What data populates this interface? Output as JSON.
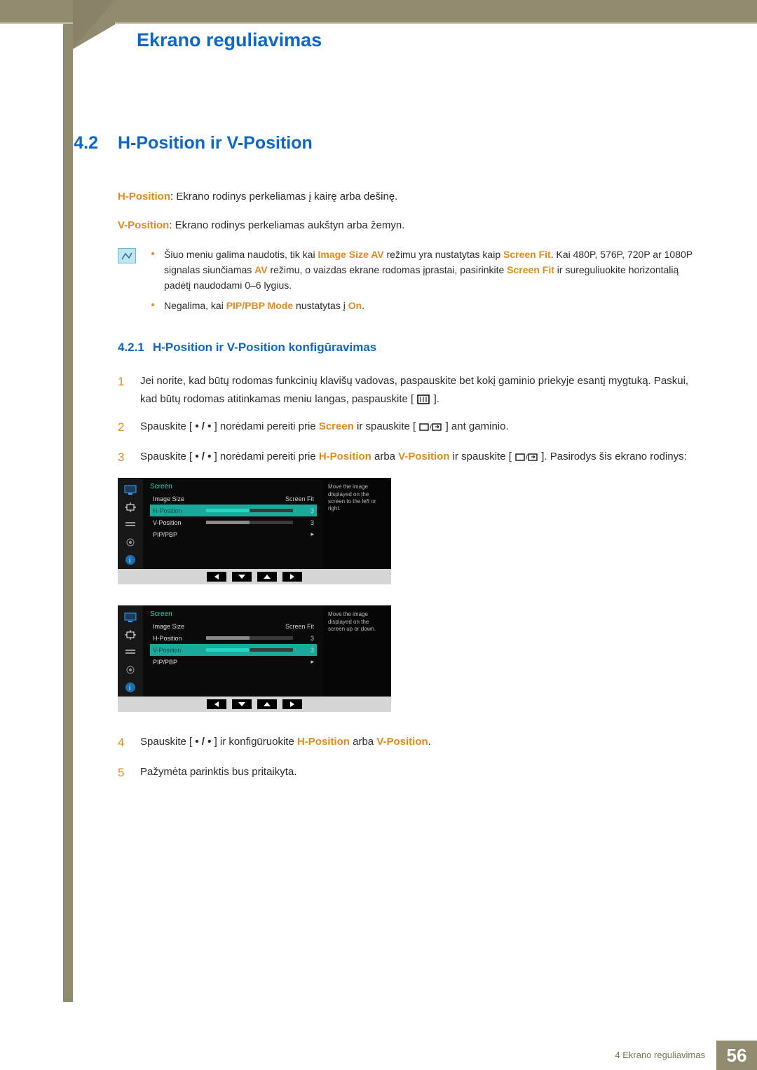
{
  "header": {
    "title": "Ekrano reguliavimas"
  },
  "section": {
    "num": "4.2",
    "title": "H-Position ir V-Position"
  },
  "intro": {
    "hpos_label": "H-Position",
    "hpos_text": ": Ekrano rodinys perkeliamas į kairę arba dešinę.",
    "vpos_label": "V-Position",
    "vpos_text": ": Ekrano rodinys perkeliamas aukštyn arba žemyn."
  },
  "note": {
    "b1_a": "Šiuo meniu galima naudotis, tik kai ",
    "b1_k1": "Image Size AV",
    "b1_b": " režimu yra nustatytas kaip ",
    "b1_k2": "Screen Fit",
    "b1_c": ". Kai 480P, 576P, 720P ar 1080P signalas siunčiamas ",
    "b1_k3": "AV",
    "b1_d": " režimu, o vaizdas ekrane rodomas įprastai, pasirinkite ",
    "b1_k4": "Screen Fit",
    "b1_e": " ir sureguliuokite horizontalią padėtį naudodami 0–6 lygius.",
    "b2_a": "Negalima, kai ",
    "b2_k1": "PIP/PBP Mode",
    "b2_b": " nustatytas į ",
    "b2_k2": "On",
    "b2_c": "."
  },
  "subsection": {
    "num": "4.2.1",
    "title": "H-Position ir V-Position konfigūravimas"
  },
  "steps": {
    "s1": "Jei norite, kad būtų rodomas funkcinių klavišų vadovas, paspauskite bet kokį gaminio priekyje esantį mygtuką. Paskui, kad būtų rodomas atitinkamas meniu langas, paspauskite [",
    "s1b": "].",
    "s2a": "Spauskite [",
    "s2b": "] norėdami pereiti prie ",
    "s2k": "Screen",
    "s2c": " ir spauskite [",
    "s2d": "] ant gaminio.",
    "s3a": "Spauskite [",
    "s3b": "] norėdami pereiti prie ",
    "s3k1": "H-Position",
    "s3mid": " arba ",
    "s3k2": "V-Position",
    "s3c": " ir spauskite [",
    "s3d": "]. Pasirodys šis ekrano rodinys:",
    "s4a": "Spauskite [",
    "s4b": "] ir konfigūruokite ",
    "s4k1": "H-Position",
    "s4mid": " arba ",
    "s4k2": "V-Position",
    "s4c": ".",
    "s5": "Pažymėta parinktis bus pritaikyta.",
    "n1": "1",
    "n2": "2",
    "n3": "3",
    "n4": "4",
    "n5": "5",
    "dot_sep": " • / • "
  },
  "osd1": {
    "heading": "Screen",
    "r1_label": "Image Size",
    "r1_val": "Screen Fit",
    "r2_label": "H-Position",
    "r2_val": "3",
    "r3_label": "V-Position",
    "r3_val": "3",
    "r4_label": "PIP/PBP",
    "tip": "Move the image displayed on the screen to the left or right."
  },
  "osd2": {
    "heading": "Screen",
    "r1_label": "Image Size",
    "r1_val": "Screen Fit",
    "r2_label": "H-Position",
    "r2_val": "3",
    "r3_label": "V-Position",
    "r3_val": "3",
    "r4_label": "PIP/PBP",
    "tip": "Move the image displayed on the screen up or down."
  },
  "footer": {
    "label": "4 Ekrano reguliavimas",
    "page": "56"
  }
}
